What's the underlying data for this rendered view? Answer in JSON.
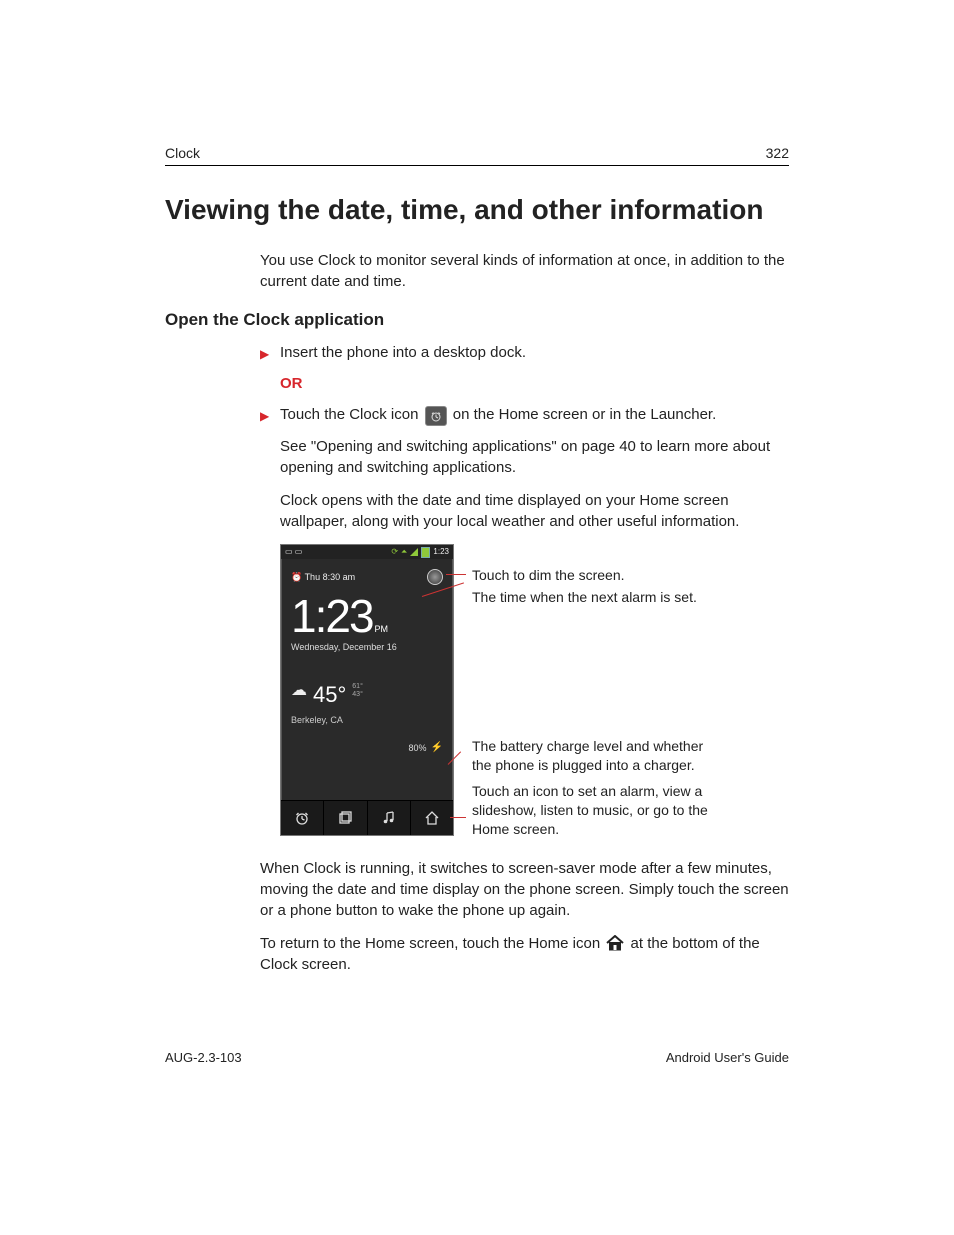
{
  "header": {
    "section": "Clock",
    "page_number": "322"
  },
  "title": "Viewing the date, time, and other information",
  "intro": "You use Clock to monitor several kinds of information at once, in addition to the current date and time.",
  "subhead": "Open the Clock application",
  "steps": {
    "s1": "Insert the phone into a desktop dock.",
    "or": "OR",
    "s2_pre": "Touch the Clock icon ",
    "s2_post": " on the Home screen or in the Launcher."
  },
  "paras": {
    "p1": "See \"Opening and switching applications\" on page 40 to learn more about opening and switching applications.",
    "p2": "Clock opens with the date and time displayed on your Home screen wallpaper, along with your local weather and other useful information.",
    "p3": "When Clock is running, it switches to screen-saver mode after a few minutes, moving the date and time display on the phone screen. Simply touch the screen or a phone button to wake the phone up again.",
    "p4_pre": "To return to the Home screen, touch the Home icon ",
    "p4_post": " at the bottom of the Clock screen."
  },
  "screenshot": {
    "status_time": "1:23",
    "alarm_label": "Thu 8:30 am",
    "big_time": "1:23",
    "ampm": "PM",
    "date": "Wednesday, December 16",
    "temp": "45°",
    "hi": "61°",
    "lo": "43°",
    "city": "Berkeley, CA",
    "battery": "80%"
  },
  "callouts": {
    "c1": "Touch to dim the screen.",
    "c2": "The time when the next alarm is set.",
    "c3": "The battery charge level and whether the phone is plugged into a charger.",
    "c4": "Touch an icon to set an alarm, view a slideshow, listen to music, or go to the Home screen."
  },
  "footer": {
    "left": "AUG-2.3-103",
    "right": "Android User's Guide"
  }
}
